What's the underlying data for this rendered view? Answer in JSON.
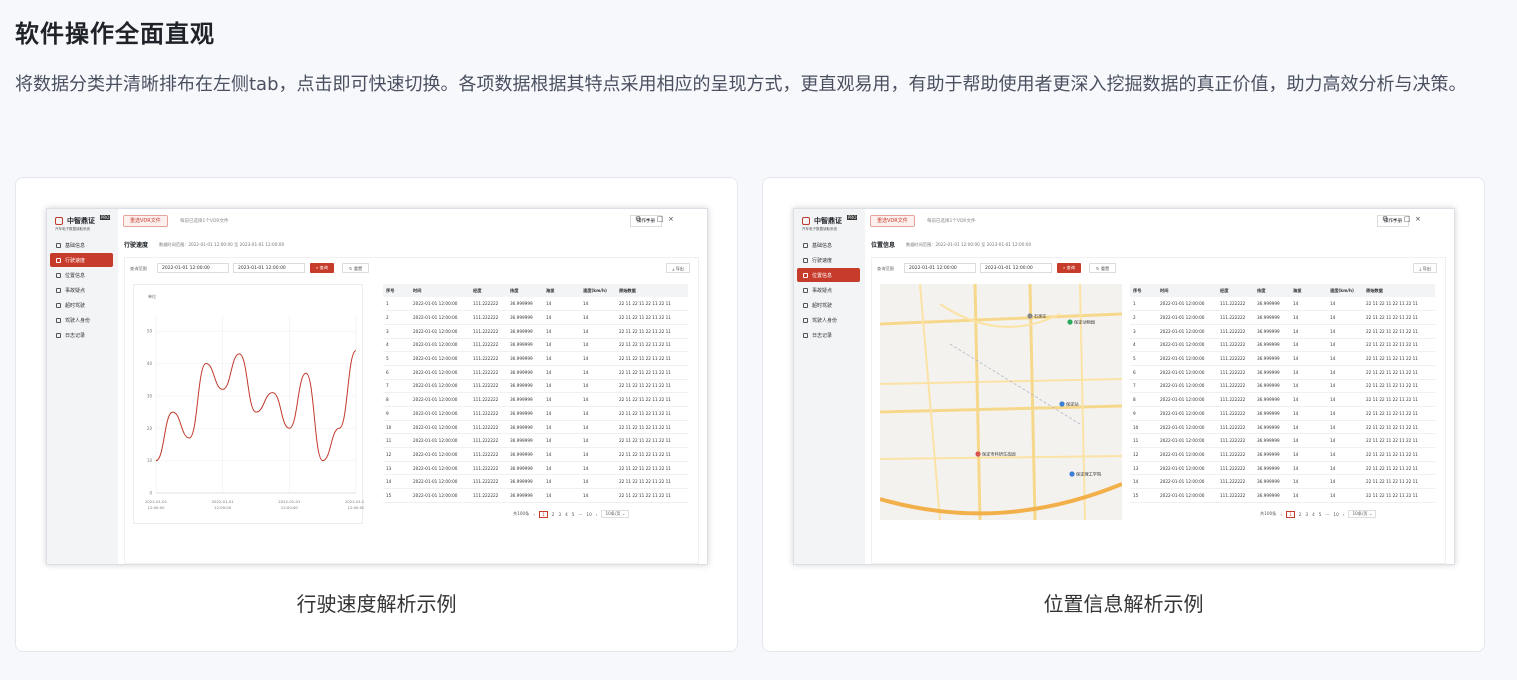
{
  "header": {
    "title": "软件操作全面直观",
    "description": "将数据分类并清晰排布在左侧tab，点击即可快速切换。各项数据根据其特点采用相应的呈现方式，更直观易用，有助于帮助使用者更深入挖掘数据的真正价值，助力高效分析与决策。"
  },
  "app": {
    "brand": "中智鼎证",
    "pro_badge": "PRO",
    "subtitle": "汽车电子数据读取系统",
    "select_button": "重选VDR文件",
    "select_hint": "每前已选择1个VDR文件",
    "manual_button": "操作手册",
    "query_label": "查询范围",
    "date_from": "2022-01-01 12:00:00",
    "date_to": "2023-01-01 12:00:00",
    "search_button": "查询",
    "reset_button": "重置",
    "export_button": "导出",
    "range_text": "数据时间范围：2022-01-01 12:00:00 至 2023-01-01 12:00:00",
    "nav": [
      "基础信息",
      "行驶速度",
      "位置信息",
      "事故疑点",
      "超时驾驶",
      "驾驶人身份",
      "日志记录"
    ],
    "columns": [
      "序号",
      "时间",
      "经度",
      "纬度",
      "海拔",
      "速度(km/h)",
      "原始数据"
    ],
    "row": {
      "time": "2022-01-01 12:00:00",
      "lng": "111.222222",
      "lat": "36.999999",
      "alt": "14",
      "speed": "14",
      "raw": "22 11 22 11 22 11 22 11"
    },
    "row_count": 15,
    "pagination": {
      "total": "共100条",
      "pages": [
        "1",
        "2",
        "3",
        "4",
        "5",
        "···",
        "10"
      ],
      "size": "10条/页"
    }
  },
  "examples": [
    {
      "section": "行驶速度",
      "caption": "行驶速度解析示例",
      "active_nav": 1
    },
    {
      "section": "位置信息",
      "caption": "位置信息解析示例",
      "active_nav": 2
    }
  ],
  "chart_data": {
    "type": "line",
    "ylabel": "单位",
    "ylim": [
      0,
      55
    ],
    "y_ticks": [
      0,
      10,
      20,
      30,
      40,
      50
    ],
    "x_ticks": [
      "2022-01-01 12:00:00",
      "2022-01-01 12:00:00",
      "2022-01-01 12:00:00",
      "2022-01-01 12:00:00"
    ],
    "x": [
      0,
      1,
      2,
      3,
      4,
      5,
      6,
      7,
      8,
      9,
      10,
      11,
      12
    ],
    "values": [
      10,
      25,
      17,
      40,
      32,
      43,
      25,
      31,
      20,
      37,
      10,
      20,
      44
    ],
    "color": "#c0392b"
  },
  "map": {
    "labels": [
      "保定动物园",
      "保定站",
      "保定市科研生态园",
      "保定理工学院",
      "石家庄"
    ]
  }
}
